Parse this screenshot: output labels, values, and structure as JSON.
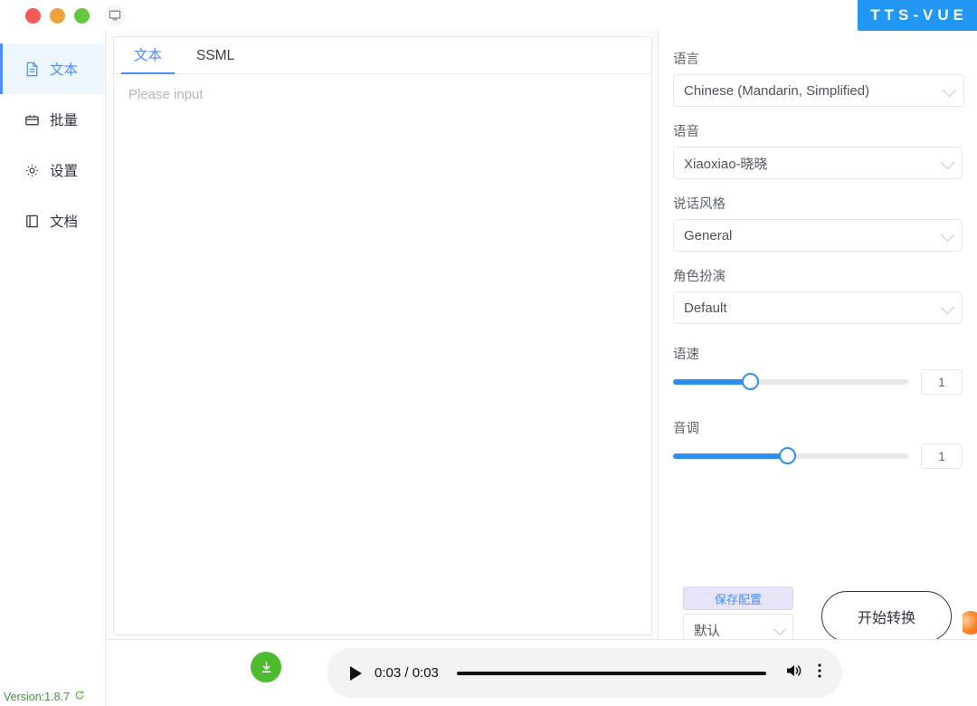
{
  "titlebar": {
    "window_controls": [
      "close",
      "minimize",
      "maximize"
    ],
    "display_icon": "monitor-icon",
    "logo": "TTS-VUE",
    "logo_color": "#2196f3"
  },
  "sidebar": {
    "items": [
      {
        "label": "文本",
        "icon": "document-icon",
        "active": true
      },
      {
        "label": "批量",
        "icon": "box-icon",
        "active": false
      },
      {
        "label": "设置",
        "icon": "gear-icon",
        "active": false
      },
      {
        "label": "文档",
        "icon": "book-icon",
        "active": false
      }
    ],
    "version_text": "Version:1.8.7",
    "refresh_icon": "refresh-icon",
    "active_color": "#4b8df8"
  },
  "editor": {
    "tabs": [
      {
        "label": "文本",
        "active": true
      },
      {
        "label": "SSML",
        "active": false
      }
    ],
    "placeholder": "Please input",
    "value": ""
  },
  "settings": {
    "language": {
      "label": "语言",
      "value": "Chinese (Mandarin, Simplified)"
    },
    "voice": {
      "label": "语音",
      "value": "Xiaoxiao-晓晓"
    },
    "style": {
      "label": "说话风格",
      "value": "General"
    },
    "role": {
      "label": "角色扮演",
      "value": "Default"
    },
    "rate": {
      "label": "语速",
      "value": "1",
      "percent": 33
    },
    "pitch": {
      "label": "音调",
      "value": "1",
      "percent": 49
    },
    "slider_color": "#2f8ef4"
  },
  "actions": {
    "save_label": "保存配置",
    "preset_value": "默认",
    "convert_label": "开始转换",
    "save_bg": "#e7e6f8",
    "save_text_color": "#4b8df8"
  },
  "player": {
    "download_icon": "download-icon",
    "download_color": "#4cbb2e",
    "play_icon": "play-icon",
    "time": "0:03 / 0:03",
    "progress_percent": 100,
    "volume_icon": "volume-icon",
    "menu_icon": "kebab-menu-icon"
  }
}
